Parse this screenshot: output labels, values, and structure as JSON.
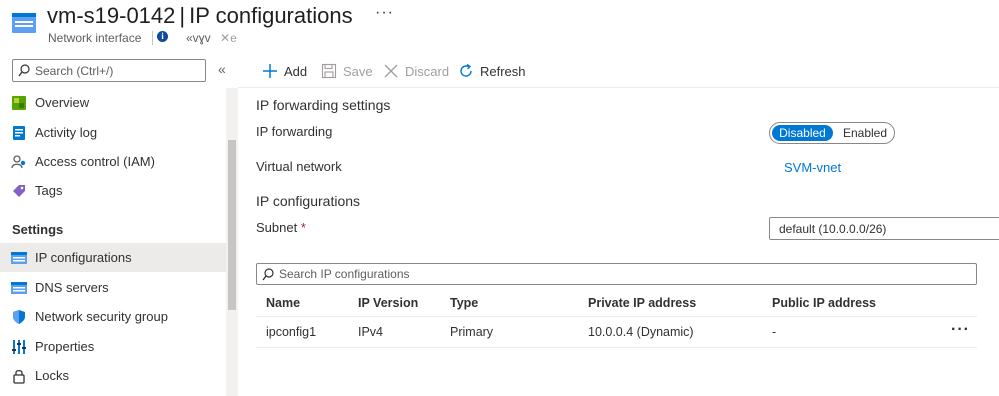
{
  "header": {
    "resource_name": "vm-s19-0142",
    "separator": "|",
    "page_name": "IP configurations",
    "more": "···",
    "resource_type": "Network interface",
    "garbled_text": "«vɣv",
    "pin_text": "✕e"
  },
  "sidebar": {
    "search_placeholder": "Search (Ctrl+/)",
    "collapse": "«",
    "items": [
      {
        "label": "Overview",
        "icon": "overview-icon"
      },
      {
        "label": "Activity log",
        "icon": "activity-log-icon"
      },
      {
        "label": "Access control (IAM)",
        "icon": "iam-icon"
      },
      {
        "label": "Tags",
        "icon": "tag-icon"
      }
    ],
    "settings_label": "Settings",
    "settings_items": [
      {
        "label": "IP configurations",
        "icon": "ip-config-icon",
        "active": true
      },
      {
        "label": "DNS servers",
        "icon": "dns-icon"
      },
      {
        "label": "Network security group",
        "icon": "shield-icon"
      },
      {
        "label": "Properties",
        "icon": "properties-icon"
      },
      {
        "label": "Locks",
        "icon": "lock-icon"
      }
    ]
  },
  "toolbar": {
    "add": "Add",
    "save": "Save",
    "discard": "Discard",
    "refresh": "Refresh"
  },
  "forwarding": {
    "section_title": "IP forwarding settings",
    "label": "IP forwarding",
    "options": [
      "Disabled",
      "Enabled"
    ],
    "selected": "Disabled",
    "vnet_label": "Virtual network",
    "vnet_value": "SVM-vnet"
  },
  "ipconfig": {
    "section_title": "IP configurations",
    "subnet_label": "Subnet",
    "required_mark": "*",
    "subnet_value": "default (10.0.0.0/26)",
    "search_placeholder": "Search IP configurations",
    "columns": [
      "Name",
      "IP Version",
      "Type",
      "Private IP address",
      "Public IP address"
    ],
    "rows": [
      {
        "name": "ipconfig1",
        "version": "IPv4",
        "type": "Primary",
        "private_ip": "10.0.0.4 (Dynamic)",
        "public_ip": "-",
        "more": "···"
      }
    ]
  },
  "colors": {
    "accent": "#0078d4",
    "active_nav": "#edebe9"
  }
}
